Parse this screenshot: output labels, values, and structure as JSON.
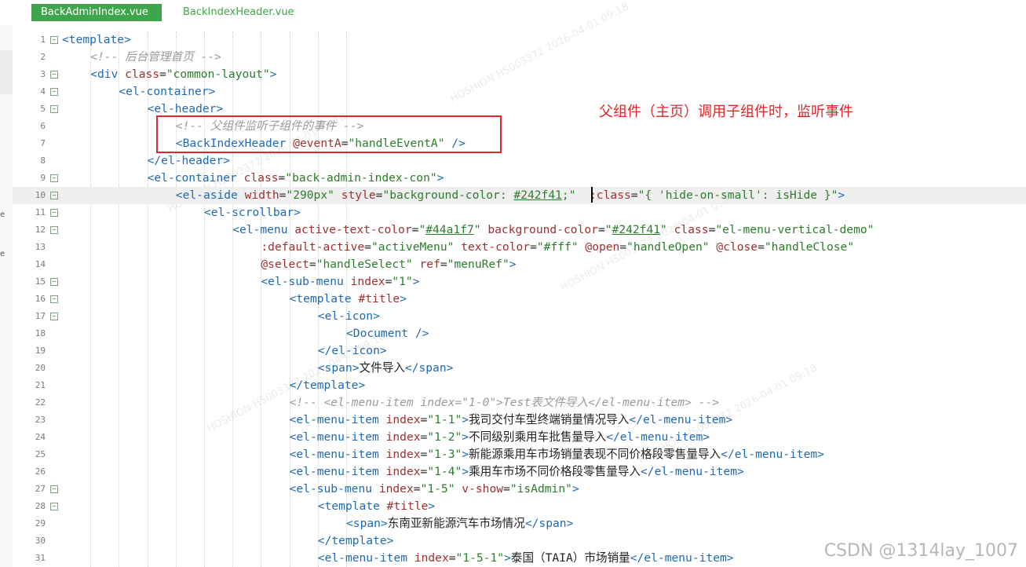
{
  "tabs": [
    {
      "label": "BackAdminIndex.vue",
      "active": true
    },
    {
      "label": "BackIndexHeader.vue",
      "active": false
    }
  ],
  "left_strip": [
    "e",
    "e"
  ],
  "annotation": "父组件（主页）调用子组件时，监听事件",
  "watermark": "CSDN @1314lay_1007",
  "background_watermark": "HOSHION HS003372 2026-04-01 09:18",
  "colors": {
    "tab_active": "#3fa54b",
    "annotation": "#e0262a",
    "tag": "#1f6ab5",
    "attr": "#a03030",
    "string": "#2a7d2a"
  },
  "lines": [
    {
      "n": "1",
      "fold": true,
      "indent": 0,
      "tokens": [
        [
          "t",
          "<template>"
        ]
      ]
    },
    {
      "n": "2",
      "fold": false,
      "indent": 1,
      "tokens": [
        [
          "c",
          "<!-- 后台管理首页 -->"
        ]
      ]
    },
    {
      "n": "3",
      "fold": true,
      "indent": 1,
      "tokens": [
        [
          "t",
          "<div "
        ],
        [
          "a",
          "class"
        ],
        [
          "x",
          "="
        ],
        [
          "s",
          "\"common-layout\""
        ],
        [
          "t",
          ">"
        ]
      ]
    },
    {
      "n": "4",
      "fold": true,
      "indent": 2,
      "tokens": [
        [
          "t",
          "<el-container>"
        ]
      ]
    },
    {
      "n": "5",
      "fold": true,
      "indent": 3,
      "tokens": [
        [
          "t",
          "<el-header>"
        ]
      ]
    },
    {
      "n": "6",
      "fold": false,
      "indent": 4,
      "tokens": [
        [
          "c",
          "<!-- 父组件监听子组件的事件 -->"
        ]
      ]
    },
    {
      "n": "7",
      "fold": false,
      "indent": 4,
      "tokens": [
        [
          "t",
          "<BackIndexHeader "
        ],
        [
          "a",
          "@eventA"
        ],
        [
          "x",
          "="
        ],
        [
          "s",
          "\"handleEventA\""
        ],
        [
          "t",
          " />"
        ]
      ]
    },
    {
      "n": "8",
      "fold": false,
      "indent": 3,
      "tokens": [
        [
          "t",
          "</el-header>"
        ]
      ]
    },
    {
      "n": "9",
      "fold": true,
      "indent": 3,
      "tokens": [
        [
          "t",
          "<el-container "
        ],
        [
          "a",
          "class"
        ],
        [
          "x",
          "="
        ],
        [
          "s",
          "\"back-admin-index-con\""
        ],
        [
          "t",
          ">"
        ]
      ]
    },
    {
      "n": "10",
      "fold": true,
      "indent": 4,
      "hl": true,
      "tokens": [
        [
          "t",
          "<el-aside "
        ],
        [
          "a",
          "width"
        ],
        [
          "x",
          "="
        ],
        [
          "s",
          "\"290px\""
        ],
        [
          "x",
          " "
        ],
        [
          "a",
          "style"
        ],
        [
          "x",
          "="
        ],
        [
          "s",
          "\"background-color: "
        ],
        [
          "su",
          "#242f41"
        ],
        [
          "s",
          ";\""
        ],
        [
          "x",
          "  "
        ],
        [
          "a",
          ":class"
        ],
        [
          "x",
          "="
        ],
        [
          "s",
          "\"{ 'hide-on-small': isHide }\""
        ],
        [
          "t",
          ">"
        ]
      ]
    },
    {
      "n": "11",
      "fold": true,
      "indent": 5,
      "tokens": [
        [
          "t",
          "<el-scrollbar>"
        ]
      ]
    },
    {
      "n": "12",
      "fold": true,
      "indent": 6,
      "tokens": [
        [
          "t",
          "<el-menu "
        ],
        [
          "a",
          "active-text-color"
        ],
        [
          "x",
          "="
        ],
        [
          "s",
          "\""
        ],
        [
          "su",
          "#44a1f7"
        ],
        [
          "s",
          "\""
        ],
        [
          "x",
          " "
        ],
        [
          "a",
          "background-color"
        ],
        [
          "x",
          "="
        ],
        [
          "s",
          "\""
        ],
        [
          "su",
          "#242f41"
        ],
        [
          "s",
          "\""
        ],
        [
          "x",
          " "
        ],
        [
          "a",
          "class"
        ],
        [
          "x",
          "="
        ],
        [
          "s",
          "\"el-menu-vertical-demo\""
        ]
      ]
    },
    {
      "n": "13",
      "fold": false,
      "indent": 7,
      "tokens": [
        [
          "a",
          ":default-active"
        ],
        [
          "x",
          "="
        ],
        [
          "s",
          "\"activeMenu\""
        ],
        [
          "x",
          " "
        ],
        [
          "a",
          "text-color"
        ],
        [
          "x",
          "="
        ],
        [
          "s",
          "\"#fff\""
        ],
        [
          "x",
          " "
        ],
        [
          "a",
          "@open"
        ],
        [
          "x",
          "="
        ],
        [
          "s",
          "\"handleOpen\""
        ],
        [
          "x",
          " "
        ],
        [
          "a",
          "@close"
        ],
        [
          "x",
          "="
        ],
        [
          "s",
          "\"handleClose\""
        ]
      ]
    },
    {
      "n": "14",
      "fold": false,
      "indent": 7,
      "tokens": [
        [
          "a",
          "@select"
        ],
        [
          "x",
          "="
        ],
        [
          "s",
          "\"handleSelect\""
        ],
        [
          "x",
          " "
        ],
        [
          "a",
          "ref"
        ],
        [
          "x",
          "="
        ],
        [
          "s",
          "\"menuRef\""
        ],
        [
          "t",
          ">"
        ]
      ]
    },
    {
      "n": "15",
      "fold": true,
      "indent": 7,
      "tokens": [
        [
          "t",
          "<el-sub-menu "
        ],
        [
          "a",
          "index"
        ],
        [
          "x",
          "="
        ],
        [
          "s",
          "\"1\""
        ],
        [
          "t",
          ">"
        ]
      ]
    },
    {
      "n": "16",
      "fold": true,
      "indent": 8,
      "tokens": [
        [
          "t",
          "<template "
        ],
        [
          "a",
          "#title"
        ],
        [
          "t",
          ">"
        ]
      ]
    },
    {
      "n": "17",
      "fold": true,
      "indent": 9,
      "tokens": [
        [
          "t",
          "<el-icon>"
        ]
      ]
    },
    {
      "n": "18",
      "fold": false,
      "indent": 10,
      "tokens": [
        [
          "t",
          "<Document />"
        ]
      ]
    },
    {
      "n": "19",
      "fold": false,
      "indent": 9,
      "tokens": [
        [
          "t",
          "</el-icon>"
        ]
      ]
    },
    {
      "n": "20",
      "fold": false,
      "indent": 9,
      "tokens": [
        [
          "t",
          "<span>"
        ],
        [
          "x",
          "文件导入"
        ],
        [
          "t",
          "</span>"
        ]
      ]
    },
    {
      "n": "21",
      "fold": false,
      "indent": 8,
      "tokens": [
        [
          "t",
          "</template>"
        ]
      ]
    },
    {
      "n": "22",
      "fold": false,
      "indent": 8,
      "tokens": [
        [
          "c",
          "<!-- <el-menu-item index=\"1-0\">Test表文件导入</el-menu-item> -->"
        ]
      ]
    },
    {
      "n": "23",
      "fold": false,
      "indent": 8,
      "tokens": [
        [
          "t",
          "<el-menu-item "
        ],
        [
          "a",
          "index"
        ],
        [
          "x",
          "="
        ],
        [
          "s",
          "\"1-1\""
        ],
        [
          "t",
          ">"
        ],
        [
          "x",
          "我司交付车型终端销量情况导入"
        ],
        [
          "t",
          "</el-menu-item>"
        ]
      ]
    },
    {
      "n": "24",
      "fold": false,
      "indent": 8,
      "tokens": [
        [
          "t",
          "<el-menu-item "
        ],
        [
          "a",
          "index"
        ],
        [
          "x",
          "="
        ],
        [
          "s",
          "\"1-2\""
        ],
        [
          "t",
          ">"
        ],
        [
          "x",
          "不同级别乘用车批售量导入"
        ],
        [
          "t",
          "</el-menu-item>"
        ]
      ]
    },
    {
      "n": "25",
      "fold": false,
      "indent": 8,
      "tokens": [
        [
          "t",
          "<el-menu-item "
        ],
        [
          "a",
          "index"
        ],
        [
          "x",
          "="
        ],
        [
          "s",
          "\"1-3\""
        ],
        [
          "t",
          ">"
        ],
        [
          "x",
          "新能源乘用车市场销量表现不同价格段零售量导入"
        ],
        [
          "t",
          "</el-menu-item>"
        ]
      ]
    },
    {
      "n": "26",
      "fold": false,
      "indent": 8,
      "tokens": [
        [
          "t",
          "<el-menu-item "
        ],
        [
          "a",
          "index"
        ],
        [
          "x",
          "="
        ],
        [
          "s",
          "\"1-4\""
        ],
        [
          "t",
          ">"
        ],
        [
          "x",
          "乘用车市场不同价格段零售量导入"
        ],
        [
          "t",
          "</el-menu-item>"
        ]
      ]
    },
    {
      "n": "27",
      "fold": true,
      "indent": 8,
      "tokens": [
        [
          "t",
          "<el-sub-menu "
        ],
        [
          "a",
          "index"
        ],
        [
          "x",
          "="
        ],
        [
          "s",
          "\"1-5\""
        ],
        [
          "x",
          " "
        ],
        [
          "a",
          "v-show"
        ],
        [
          "x",
          "="
        ],
        [
          "s",
          "\"isAdmin\""
        ],
        [
          "t",
          ">"
        ]
      ]
    },
    {
      "n": "28",
      "fold": true,
      "indent": 9,
      "tokens": [
        [
          "t",
          "<template "
        ],
        [
          "a",
          "#title"
        ],
        [
          "t",
          ">"
        ]
      ]
    },
    {
      "n": "29",
      "fold": false,
      "indent": 10,
      "tokens": [
        [
          "t",
          "<span>"
        ],
        [
          "x",
          "东南亚新能源汽车市场情况"
        ],
        [
          "t",
          "</span>"
        ]
      ]
    },
    {
      "n": "30",
      "fold": false,
      "indent": 9,
      "tokens": [
        [
          "t",
          "</template>"
        ]
      ]
    },
    {
      "n": "31",
      "fold": false,
      "indent": 9,
      "tokens": [
        [
          "t",
          "<el-menu-item "
        ],
        [
          "a",
          "index"
        ],
        [
          "x",
          "="
        ],
        [
          "s",
          "\"1-5-1\""
        ],
        [
          "t",
          ">"
        ],
        [
          "x",
          "泰国（TAIA）市场销量"
        ],
        [
          "t",
          "</el-menu-item>"
        ]
      ]
    }
  ]
}
